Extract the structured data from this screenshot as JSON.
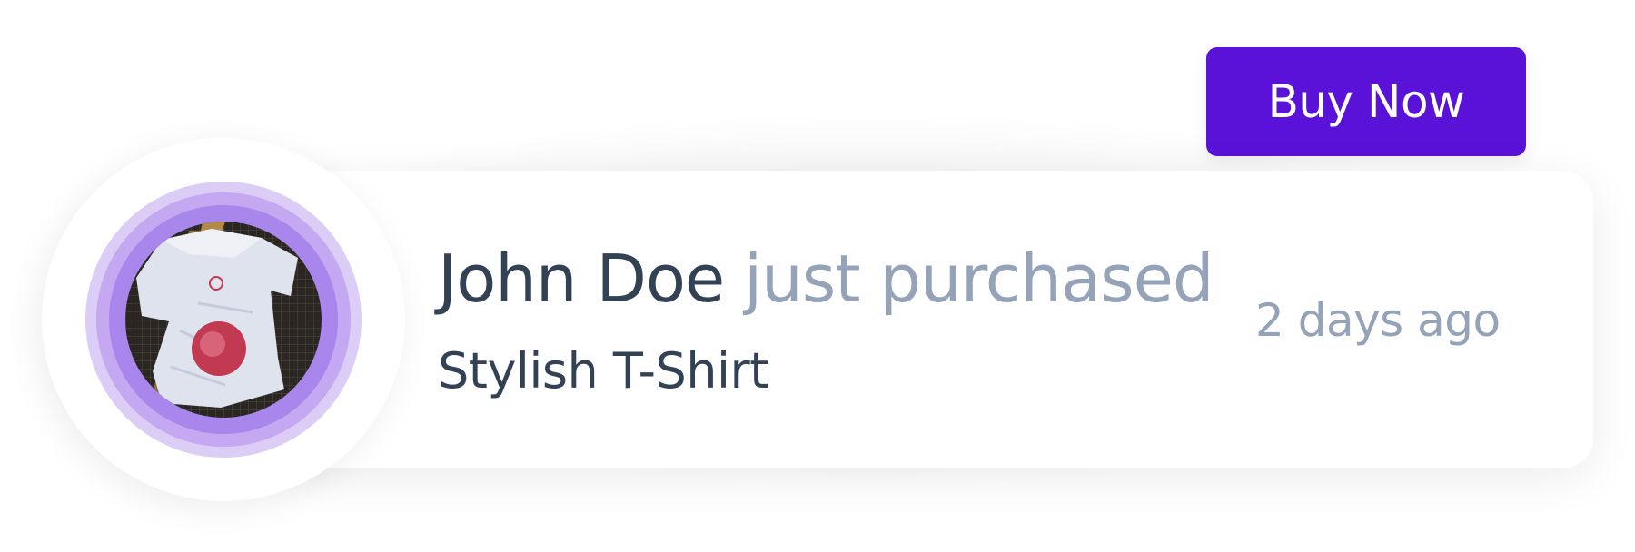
{
  "notification": {
    "buyer_name": "John Doe",
    "action_text": "just purchased",
    "product_name": "Stylish T-Shirt",
    "time_ago": "2 days ago",
    "product_image_icon": "t-shirt-product-photo"
  },
  "cta": {
    "label": "Buy Now"
  },
  "colors": {
    "accent": "#5a12d9",
    "primary_text": "#334155",
    "muted_text": "#94a3b8",
    "ring_outer": "#dccdf6",
    "ring_mid": "#c4a8f1",
    "ring_inner": "#a886ec"
  }
}
